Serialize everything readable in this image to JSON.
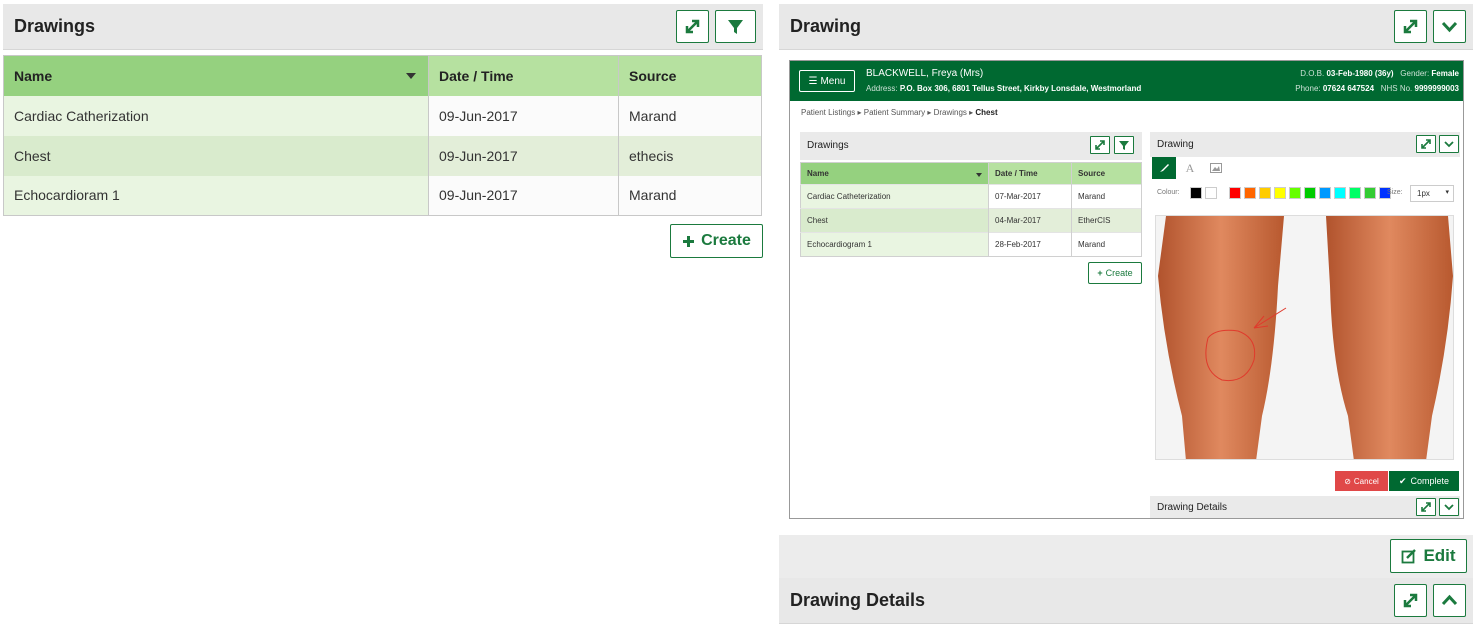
{
  "left_panel": {
    "title": "Drawings",
    "columns": [
      "Name",
      "Date / Time",
      "Source"
    ],
    "rows": [
      {
        "name": "Cardiac Catherization",
        "date": "09-Jun-2017",
        "source": "Marand"
      },
      {
        "name": "Chest",
        "date": "09-Jun-2017",
        "source": "ethecis"
      },
      {
        "name": "Echocardioram 1",
        "date": "09-Jun-2017",
        "source": "Marand"
      }
    ],
    "create_label": "Create"
  },
  "right_panel": {
    "title": "Drawing",
    "edit_label": "Edit",
    "details_title": "Drawing Details"
  },
  "screenshot": {
    "menu_label": "Menu",
    "patient_name": "BLACKWELL, Freya (Mrs)",
    "address_label": "Address:",
    "address": "P.O. Box 306, 6801 Tellus Street, Kirkby Lonsdale, Westmorland",
    "dob_label": "D.O.B.",
    "dob": "03-Feb-1980 (36y)",
    "gender_label": "Gender:",
    "gender": "Female",
    "phone_label": "Phone:",
    "phone": "07624 647524",
    "nhs_label": "NHS No.",
    "nhs": "9999999003",
    "breadcrumbs": [
      "Patient Listings",
      "Patient Summary",
      "Drawings",
      "Chest"
    ],
    "drawings_title": "Drawings",
    "columns": [
      "Name",
      "Date / Time",
      "Source"
    ],
    "rows": [
      {
        "name": "Cardiac Catheterization",
        "date": "07-Mar-2017",
        "source": "Marand"
      },
      {
        "name": "Chest",
        "date": "04-Mar-2017",
        "source": "EtherCIS"
      },
      {
        "name": "Echocardiogram  1",
        "date": "28-Feb-2017",
        "source": "Marand"
      }
    ],
    "create_label": "Create",
    "drawing_title": "Drawing",
    "colour_label": "Colour:",
    "size_label": "Size:",
    "size_value": "1px",
    "palette": [
      "#000000",
      "#ffffff",
      "#ff0000",
      "#ff6600",
      "#ffcc00",
      "#ffff00",
      "#66ff00",
      "#00cc00",
      "#0099ff",
      "#00ffff",
      "#00ff66",
      "#33cc33",
      "#0033ff"
    ],
    "cancel_label": "Cancel",
    "complete_label": "Complete",
    "details_title": "Drawing Details"
  },
  "colors": {
    "brand_green": "#1b7a3e",
    "header_green": "#006931",
    "table_header": "#b6e1a0"
  },
  "icons": [
    "expand-icon",
    "filter-icon",
    "chevron-down-icon",
    "chevron-up-icon",
    "plus-icon",
    "edit-icon",
    "brush-icon",
    "text-icon",
    "image-icon",
    "cancel-icon",
    "check-icon",
    "menu-icon"
  ]
}
